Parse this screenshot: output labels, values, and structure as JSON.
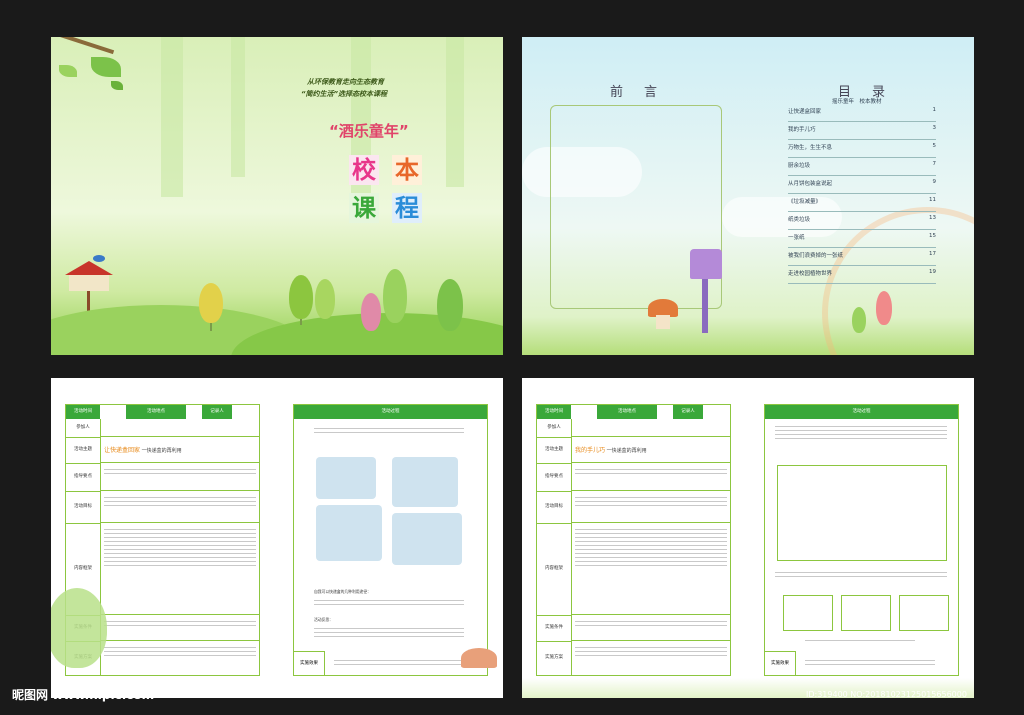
{
  "cover": {
    "sub_line1": "从环保教育走向生态教育",
    "sub_line2": "“简约生活”选择态校本课程",
    "tagline": "“酒乐童年”",
    "big_chars": [
      "校",
      "本",
      "课",
      "程"
    ]
  },
  "preface": {
    "title": "前　言"
  },
  "toc": {
    "title": "目　录",
    "subtitle": "摇乐童年　校本教材",
    "items": [
      {
        "label": "让快递盒回家",
        "page": "1"
      },
      {
        "label": "我的手儿巧",
        "page": "3"
      },
      {
        "label": "万物生，生生不息",
        "page": "5"
      },
      {
        "label": "厨余垃圾",
        "page": "7"
      },
      {
        "label": "从月饼包装盒说起",
        "page": "9"
      },
      {
        "label": "《垃圾减量》",
        "page": "11"
      },
      {
        "label": "纸类垃圾",
        "page": "13"
      },
      {
        "label": "一张纸",
        "page": "15"
      },
      {
        "label": "被我们浪费掉的一张纸",
        "page": "17"
      },
      {
        "label": "走进校园植物世界",
        "page": "19"
      }
    ]
  },
  "lesson1": {
    "header": [
      "活动时间",
      "活动地点",
      "记录人"
    ],
    "labels": [
      "参加人",
      "活动主题",
      "指导要点",
      "活动目标",
      "内容框架",
      "实施条件",
      "实施方案"
    ],
    "theme_main": "让快递盒回家",
    "theme_sub": " 一快递盒的再利用",
    "process_title": "活动过程",
    "effect_label": "实施效果",
    "notes": [
      "自我可以快递盒的几种利用途径：",
      "活动反思："
    ]
  },
  "lesson2": {
    "header": [
      "活动时间",
      "活动地点",
      "记录人"
    ],
    "labels": [
      "参加人",
      "活动主题",
      "指导要点",
      "活动目标",
      "内容框架",
      "实施条件",
      "实施方案"
    ],
    "theme_main": "我的手儿巧",
    "theme_sub": " 一快递盒的再利用",
    "process_title": "活动过程",
    "effect_label": "实施效果"
  },
  "watermark": {
    "logo": "昵图网 www.nipic.com",
    "id": "ID:319400 NO:20181023125015656000"
  }
}
